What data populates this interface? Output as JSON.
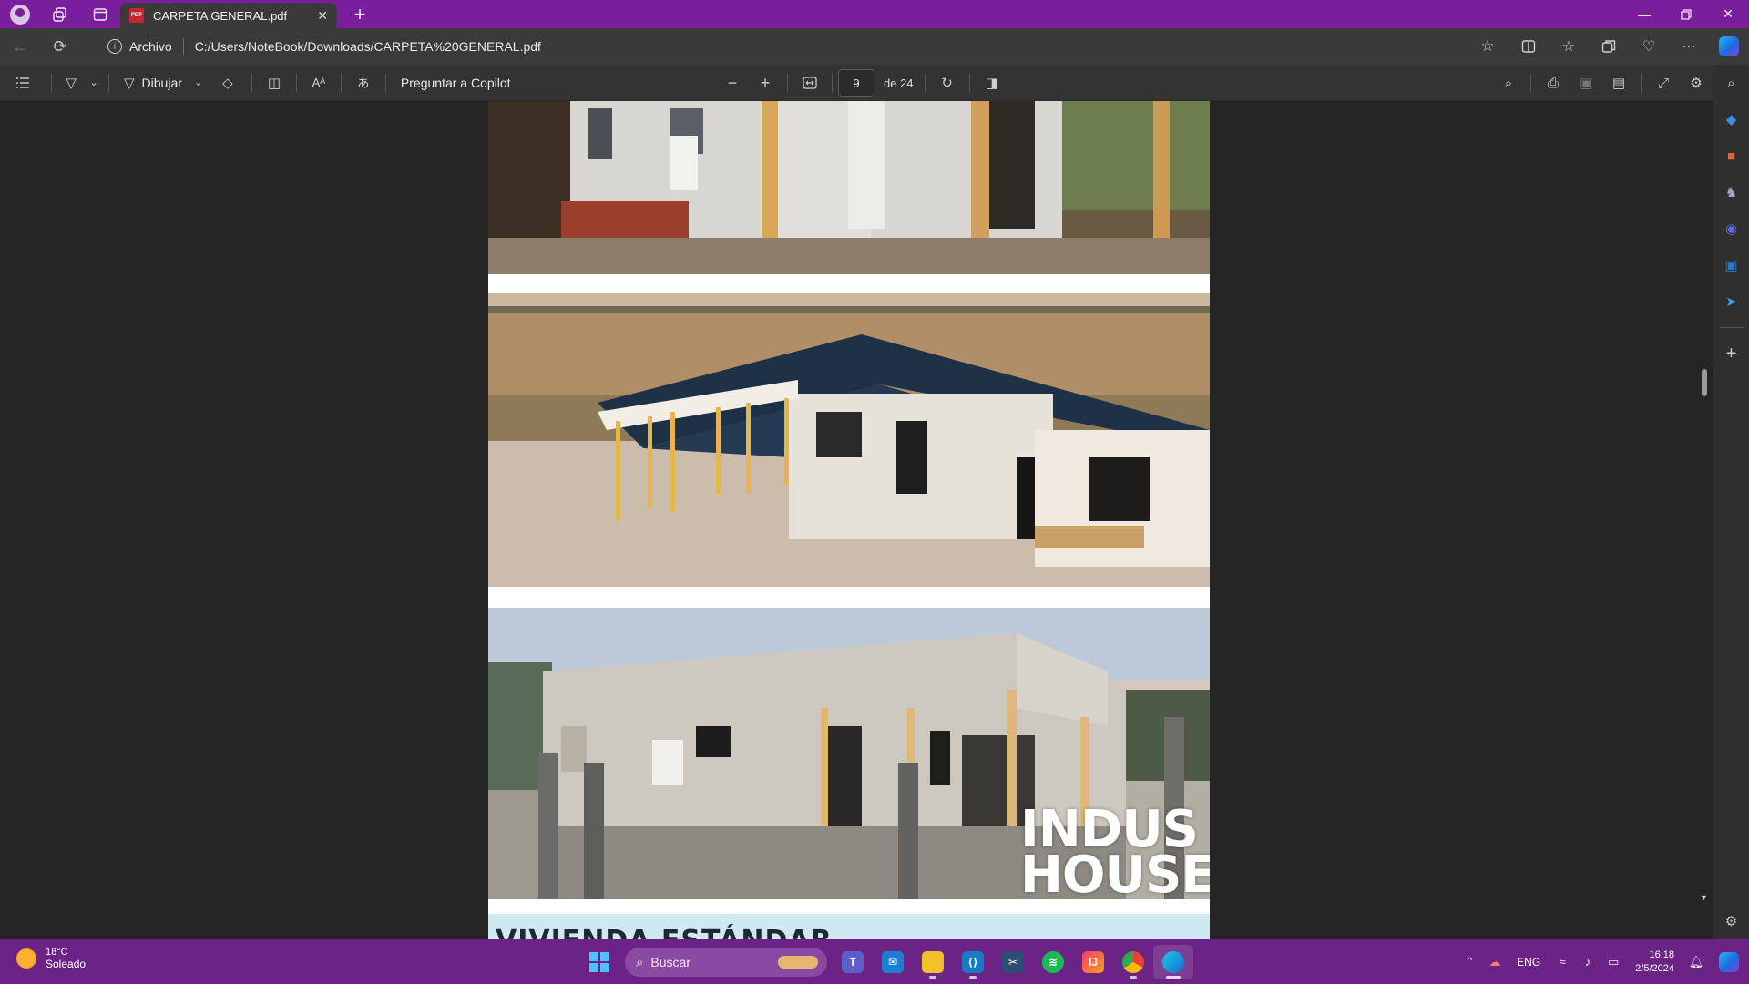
{
  "browser": {
    "tab_title": "CARPETA GENERAL.pdf",
    "site_label": "Archivo",
    "url": "C:/Users/NoteBook/Downloads/CARPETA%20GENERAL.pdf"
  },
  "pdf_toolbar": {
    "draw_label": "Dibujar",
    "copilot_label": "Preguntar a Copilot",
    "page_current": "9",
    "page_total": "de 24"
  },
  "document": {
    "logo_line1": "INDUS",
    "logo_line2": "HOUSE",
    "next_heading": "VIVIENDA ESTÁNDAR"
  },
  "taskbar": {
    "weather_temp": "18°C",
    "weather_desc": "Soleado",
    "search_label": "Buscar",
    "language": "ENG",
    "time": "16:18",
    "date": "2/5/2024"
  },
  "colors": {
    "titlebar": "#7a1f9c",
    "taskbar": "#6b2486",
    "accent": "#4cc2ff"
  },
  "scroll": {
    "position_fraction": 0.36
  }
}
